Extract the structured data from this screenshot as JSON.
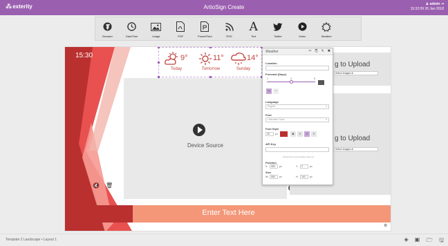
{
  "header": {
    "logo_text": "exterity",
    "app_title": "ArtioSign Create",
    "user": "admin",
    "datetime": "15:32:09 26 Jan 2018"
  },
  "toolbar": {
    "items": [
      {
        "label": "Browser",
        "icon": "globe-icon"
      },
      {
        "label": "DateTime",
        "icon": "clock-icon"
      },
      {
        "label": "Image",
        "icon": "image-icon"
      },
      {
        "label": "PDF",
        "icon": "pdf-icon"
      },
      {
        "label": "PowerPoint",
        "icon": "powerpoint-icon"
      },
      {
        "label": "RSS",
        "icon": "rss-icon"
      },
      {
        "label": "Text",
        "icon": "text-icon"
      },
      {
        "label": "Twitter",
        "icon": "twitter-icon"
      },
      {
        "label": "Video",
        "icon": "video-icon"
      },
      {
        "label": "Weather",
        "icon": "weather-icon"
      }
    ]
  },
  "canvas": {
    "time": "15:30",
    "weather": [
      {
        "temp": "9°",
        "day": "Today"
      },
      {
        "temp": "11°",
        "day": "Tomorrow"
      },
      {
        "temp": "14°",
        "day": "Sunday"
      }
    ],
    "device_source": "Device Source",
    "upload_1": {
      "text": "g to Upload",
      "select": "Select Images"
    },
    "upload_2": {
      "text": "g to Upload",
      "select": "Select Images"
    },
    "enter_text": "Enter Text Here"
  },
  "weather_panel": {
    "title": "Weather",
    "location_label": "Location",
    "location_value": "",
    "forecast_label": "Forecast (Days)",
    "forecast_min": "1",
    "forecast_mid": "3",
    "forecast_max": "5",
    "forecast_value": 3,
    "unit_c": "°C",
    "unit_f": "°F",
    "language_label": "Language",
    "language_value": "English",
    "font_label": "Font",
    "font_value": "Liberation Sans",
    "font_style_label": "Font Style",
    "font_size": "30",
    "font_size_unit": "px",
    "bold_label": "B",
    "api_key_label": "API Key",
    "powered_by": "Powered by openweathermap.org",
    "position_label": "Position",
    "pos_x_label": "X:",
    "pos_x": "580",
    "pos_y_label": "Y:",
    "pos_y": "0",
    "size_label": "Size",
    "size_w_label": "W:",
    "size_w": "580",
    "size_h_label": "H:",
    "size_h": "162",
    "unit": "px",
    "accent_color": "#9b5fb0",
    "swatch_color": "#b9302f"
  },
  "status": {
    "text": "Template 2 Landscape • Layout 1"
  }
}
